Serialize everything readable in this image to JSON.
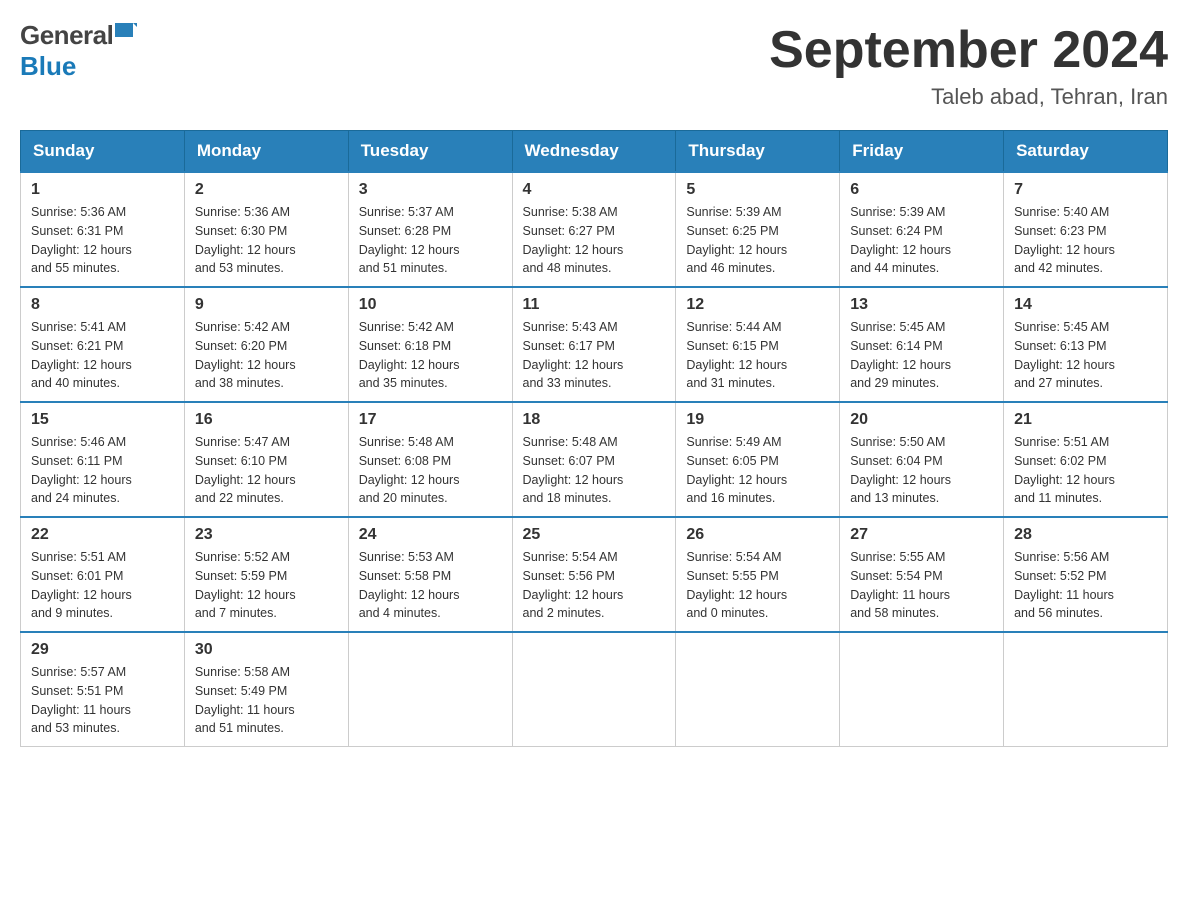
{
  "header": {
    "title": "September 2024",
    "subtitle": "Taleb abad, Tehran, Iran",
    "logo_general": "General",
    "logo_blue": "Blue"
  },
  "days_header": [
    "Sunday",
    "Monday",
    "Tuesday",
    "Wednesday",
    "Thursday",
    "Friday",
    "Saturday"
  ],
  "weeks": [
    {
      "days": [
        {
          "date": "1",
          "sunrise": "Sunrise: 5:36 AM",
          "sunset": "Sunset: 6:31 PM",
          "daylight": "Daylight: 12 hours",
          "daylight2": "and 55 minutes."
        },
        {
          "date": "2",
          "sunrise": "Sunrise: 5:36 AM",
          "sunset": "Sunset: 6:30 PM",
          "daylight": "Daylight: 12 hours",
          "daylight2": "and 53 minutes."
        },
        {
          "date": "3",
          "sunrise": "Sunrise: 5:37 AM",
          "sunset": "Sunset: 6:28 PM",
          "daylight": "Daylight: 12 hours",
          "daylight2": "and 51 minutes."
        },
        {
          "date": "4",
          "sunrise": "Sunrise: 5:38 AM",
          "sunset": "Sunset: 6:27 PM",
          "daylight": "Daylight: 12 hours",
          "daylight2": "and 48 minutes."
        },
        {
          "date": "5",
          "sunrise": "Sunrise: 5:39 AM",
          "sunset": "Sunset: 6:25 PM",
          "daylight": "Daylight: 12 hours",
          "daylight2": "and 46 minutes."
        },
        {
          "date": "6",
          "sunrise": "Sunrise: 5:39 AM",
          "sunset": "Sunset: 6:24 PM",
          "daylight": "Daylight: 12 hours",
          "daylight2": "and 44 minutes."
        },
        {
          "date": "7",
          "sunrise": "Sunrise: 5:40 AM",
          "sunset": "Sunset: 6:23 PM",
          "daylight": "Daylight: 12 hours",
          "daylight2": "and 42 minutes."
        }
      ]
    },
    {
      "days": [
        {
          "date": "8",
          "sunrise": "Sunrise: 5:41 AM",
          "sunset": "Sunset: 6:21 PM",
          "daylight": "Daylight: 12 hours",
          "daylight2": "and 40 minutes."
        },
        {
          "date": "9",
          "sunrise": "Sunrise: 5:42 AM",
          "sunset": "Sunset: 6:20 PM",
          "daylight": "Daylight: 12 hours",
          "daylight2": "and 38 minutes."
        },
        {
          "date": "10",
          "sunrise": "Sunrise: 5:42 AM",
          "sunset": "Sunset: 6:18 PM",
          "daylight": "Daylight: 12 hours",
          "daylight2": "and 35 minutes."
        },
        {
          "date": "11",
          "sunrise": "Sunrise: 5:43 AM",
          "sunset": "Sunset: 6:17 PM",
          "daylight": "Daylight: 12 hours",
          "daylight2": "and 33 minutes."
        },
        {
          "date": "12",
          "sunrise": "Sunrise: 5:44 AM",
          "sunset": "Sunset: 6:15 PM",
          "daylight": "Daylight: 12 hours",
          "daylight2": "and 31 minutes."
        },
        {
          "date": "13",
          "sunrise": "Sunrise: 5:45 AM",
          "sunset": "Sunset: 6:14 PM",
          "daylight": "Daylight: 12 hours",
          "daylight2": "and 29 minutes."
        },
        {
          "date": "14",
          "sunrise": "Sunrise: 5:45 AM",
          "sunset": "Sunset: 6:13 PM",
          "daylight": "Daylight: 12 hours",
          "daylight2": "and 27 minutes."
        }
      ]
    },
    {
      "days": [
        {
          "date": "15",
          "sunrise": "Sunrise: 5:46 AM",
          "sunset": "Sunset: 6:11 PM",
          "daylight": "Daylight: 12 hours",
          "daylight2": "and 24 minutes."
        },
        {
          "date": "16",
          "sunrise": "Sunrise: 5:47 AM",
          "sunset": "Sunset: 6:10 PM",
          "daylight": "Daylight: 12 hours",
          "daylight2": "and 22 minutes."
        },
        {
          "date": "17",
          "sunrise": "Sunrise: 5:48 AM",
          "sunset": "Sunset: 6:08 PM",
          "daylight": "Daylight: 12 hours",
          "daylight2": "and 20 minutes."
        },
        {
          "date": "18",
          "sunrise": "Sunrise: 5:48 AM",
          "sunset": "Sunset: 6:07 PM",
          "daylight": "Daylight: 12 hours",
          "daylight2": "and 18 minutes."
        },
        {
          "date": "19",
          "sunrise": "Sunrise: 5:49 AM",
          "sunset": "Sunset: 6:05 PM",
          "daylight": "Daylight: 12 hours",
          "daylight2": "and 16 minutes."
        },
        {
          "date": "20",
          "sunrise": "Sunrise: 5:50 AM",
          "sunset": "Sunset: 6:04 PM",
          "daylight": "Daylight: 12 hours",
          "daylight2": "and 13 minutes."
        },
        {
          "date": "21",
          "sunrise": "Sunrise: 5:51 AM",
          "sunset": "Sunset: 6:02 PM",
          "daylight": "Daylight: 12 hours",
          "daylight2": "and 11 minutes."
        }
      ]
    },
    {
      "days": [
        {
          "date": "22",
          "sunrise": "Sunrise: 5:51 AM",
          "sunset": "Sunset: 6:01 PM",
          "daylight": "Daylight: 12 hours",
          "daylight2": "and 9 minutes."
        },
        {
          "date": "23",
          "sunrise": "Sunrise: 5:52 AM",
          "sunset": "Sunset: 5:59 PM",
          "daylight": "Daylight: 12 hours",
          "daylight2": "and 7 minutes."
        },
        {
          "date": "24",
          "sunrise": "Sunrise: 5:53 AM",
          "sunset": "Sunset: 5:58 PM",
          "daylight": "Daylight: 12 hours",
          "daylight2": "and 4 minutes."
        },
        {
          "date": "25",
          "sunrise": "Sunrise: 5:54 AM",
          "sunset": "Sunset: 5:56 PM",
          "daylight": "Daylight: 12 hours",
          "daylight2": "and 2 minutes."
        },
        {
          "date": "26",
          "sunrise": "Sunrise: 5:54 AM",
          "sunset": "Sunset: 5:55 PM",
          "daylight": "Daylight: 12 hours",
          "daylight2": "and 0 minutes."
        },
        {
          "date": "27",
          "sunrise": "Sunrise: 5:55 AM",
          "sunset": "Sunset: 5:54 PM",
          "daylight": "Daylight: 11 hours",
          "daylight2": "and 58 minutes."
        },
        {
          "date": "28",
          "sunrise": "Sunrise: 5:56 AM",
          "sunset": "Sunset: 5:52 PM",
          "daylight": "Daylight: 11 hours",
          "daylight2": "and 56 minutes."
        }
      ]
    },
    {
      "days": [
        {
          "date": "29",
          "sunrise": "Sunrise: 5:57 AM",
          "sunset": "Sunset: 5:51 PM",
          "daylight": "Daylight: 11 hours",
          "daylight2": "and 53 minutes."
        },
        {
          "date": "30",
          "sunrise": "Sunrise: 5:58 AM",
          "sunset": "Sunset: 5:49 PM",
          "daylight": "Daylight: 11 hours",
          "daylight2": "and 51 minutes."
        },
        null,
        null,
        null,
        null,
        null
      ]
    }
  ]
}
